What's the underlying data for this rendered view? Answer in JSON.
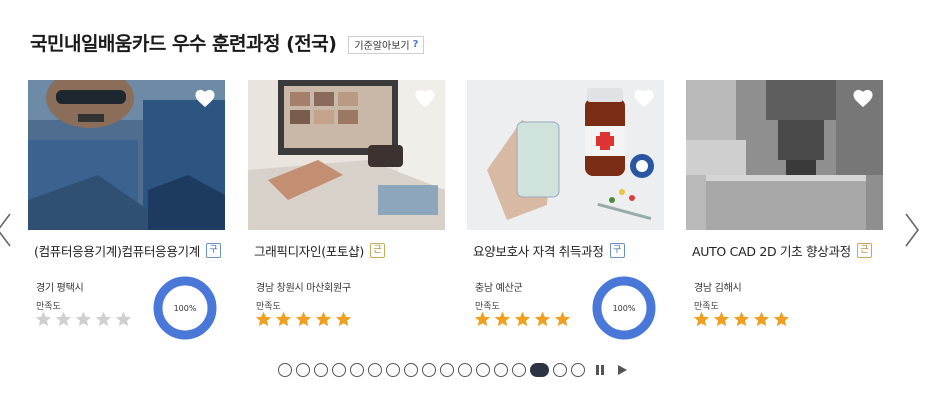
{
  "header": {
    "title": "국민내일배움카드 우수 훈련과정 (전국)",
    "criteria_button": "기준알아보기",
    "criteria_help": "?"
  },
  "navigation": {
    "prev_icon": "chevron-left-icon",
    "next_icon": "chevron-right-icon"
  },
  "rating_label": "만족도",
  "cards": [
    {
      "name": "(컴퓨터응용기계)컴퓨터응용기계",
      "badge": "구",
      "badge_color": "#3f67b0",
      "location": "경기 평택시",
      "stars": 0,
      "donut_text": "100%",
      "donut_value": 100,
      "thumb": "machinist"
    },
    {
      "name": "그래픽디자인(포토샵)",
      "badge": "근",
      "badge_color": "#a9852c",
      "location": "경남 창원시 마산회원구",
      "stars": 5,
      "thumb": "design"
    },
    {
      "name": "요양보호사 자격 취득과정",
      "badge": "구",
      "badge_color": "#3f67b0",
      "location": "충남 예산군",
      "stars": 5,
      "donut_text": "100%",
      "donut_value": 100,
      "thumb": "medical"
    },
    {
      "name": "AUTO CAD 2D 기초 향상과정",
      "badge": "근",
      "badge_color": "#a9852c",
      "location": "경남 김해시",
      "stars": 5,
      "thumb": "cnc"
    }
  ],
  "pager": {
    "total": 16,
    "active": 14,
    "pause_icon": "pause-icon",
    "play_icon": "play-icon"
  },
  "colors": {
    "donut": "#4a78d8",
    "star_filled": "#f0a020",
    "star_empty": "#d0d0d0",
    "active_dot": "#2c3444"
  }
}
